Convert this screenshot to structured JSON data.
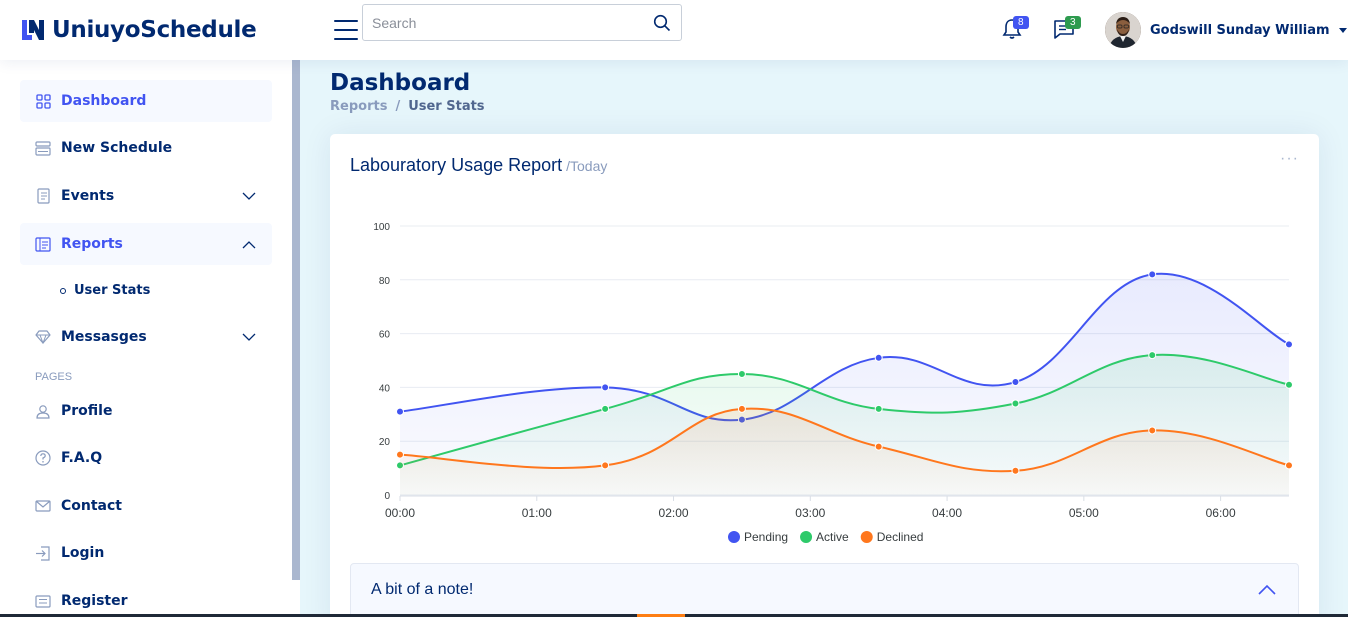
{
  "header": {
    "logo_text": "UniuyoSchedule",
    "search_placeholder": "Search",
    "notifications_count": "8",
    "messages_count": "3",
    "user_name": "Godswill Sunday William"
  },
  "sidebar": {
    "items": [
      {
        "label": "Dashboard",
        "icon": "grid-icon"
      },
      {
        "label": "New Schedule",
        "icon": "menu-app-icon"
      },
      {
        "label": "Events",
        "icon": "journal-text-icon"
      },
      {
        "label": "Reports",
        "icon": "layout-text-icon"
      },
      {
        "label": "User Stats",
        "icon": "circle-icon"
      },
      {
        "label": "Messasges",
        "icon": "gem-icon"
      },
      {
        "label": "Profile",
        "icon": "person-icon"
      },
      {
        "label": "F.A.Q",
        "icon": "question-circle-icon"
      },
      {
        "label": "Contact",
        "icon": "envelope-icon"
      },
      {
        "label": "Login",
        "icon": "box-arrow-in-right-icon"
      },
      {
        "label": "Register",
        "icon": "card-list-icon"
      }
    ],
    "pages_heading": "PAGES"
  },
  "main": {
    "title": "Dashboard",
    "breadcrumb": [
      "Reports",
      "User Stats"
    ]
  },
  "card": {
    "title": "Labouratory Usage Report",
    "subtitle": "/Today",
    "menu": "···"
  },
  "accordion": {
    "title": "A bit of a note!"
  },
  "colors": {
    "pending": "#4154f1",
    "active": "#2eca6a",
    "declined": "#ff771d",
    "brand": "#012970"
  },
  "chart_data": {
    "type": "area",
    "x": [
      "00:00",
      "01:00",
      "02:00",
      "03:00",
      "04:00",
      "05:00",
      "06:00"
    ],
    "x_points": [
      0,
      1.5,
      2.5,
      3.5,
      4.5,
      5.5,
      6.5
    ],
    "ylim": [
      0,
      100
    ],
    "yticks": [
      0,
      20,
      40,
      60,
      80,
      100
    ],
    "series": [
      {
        "name": "Pending",
        "values": [
          31,
          40,
          28,
          51,
          42,
          82,
          56
        ]
      },
      {
        "name": "Active",
        "values": [
          11,
          32,
          45,
          32,
          34,
          52,
          41
        ]
      },
      {
        "name": "Declined",
        "values": [
          15,
          11,
          32,
          18,
          9,
          24,
          11
        ]
      }
    ],
    "legend_position": "bottom-center"
  }
}
